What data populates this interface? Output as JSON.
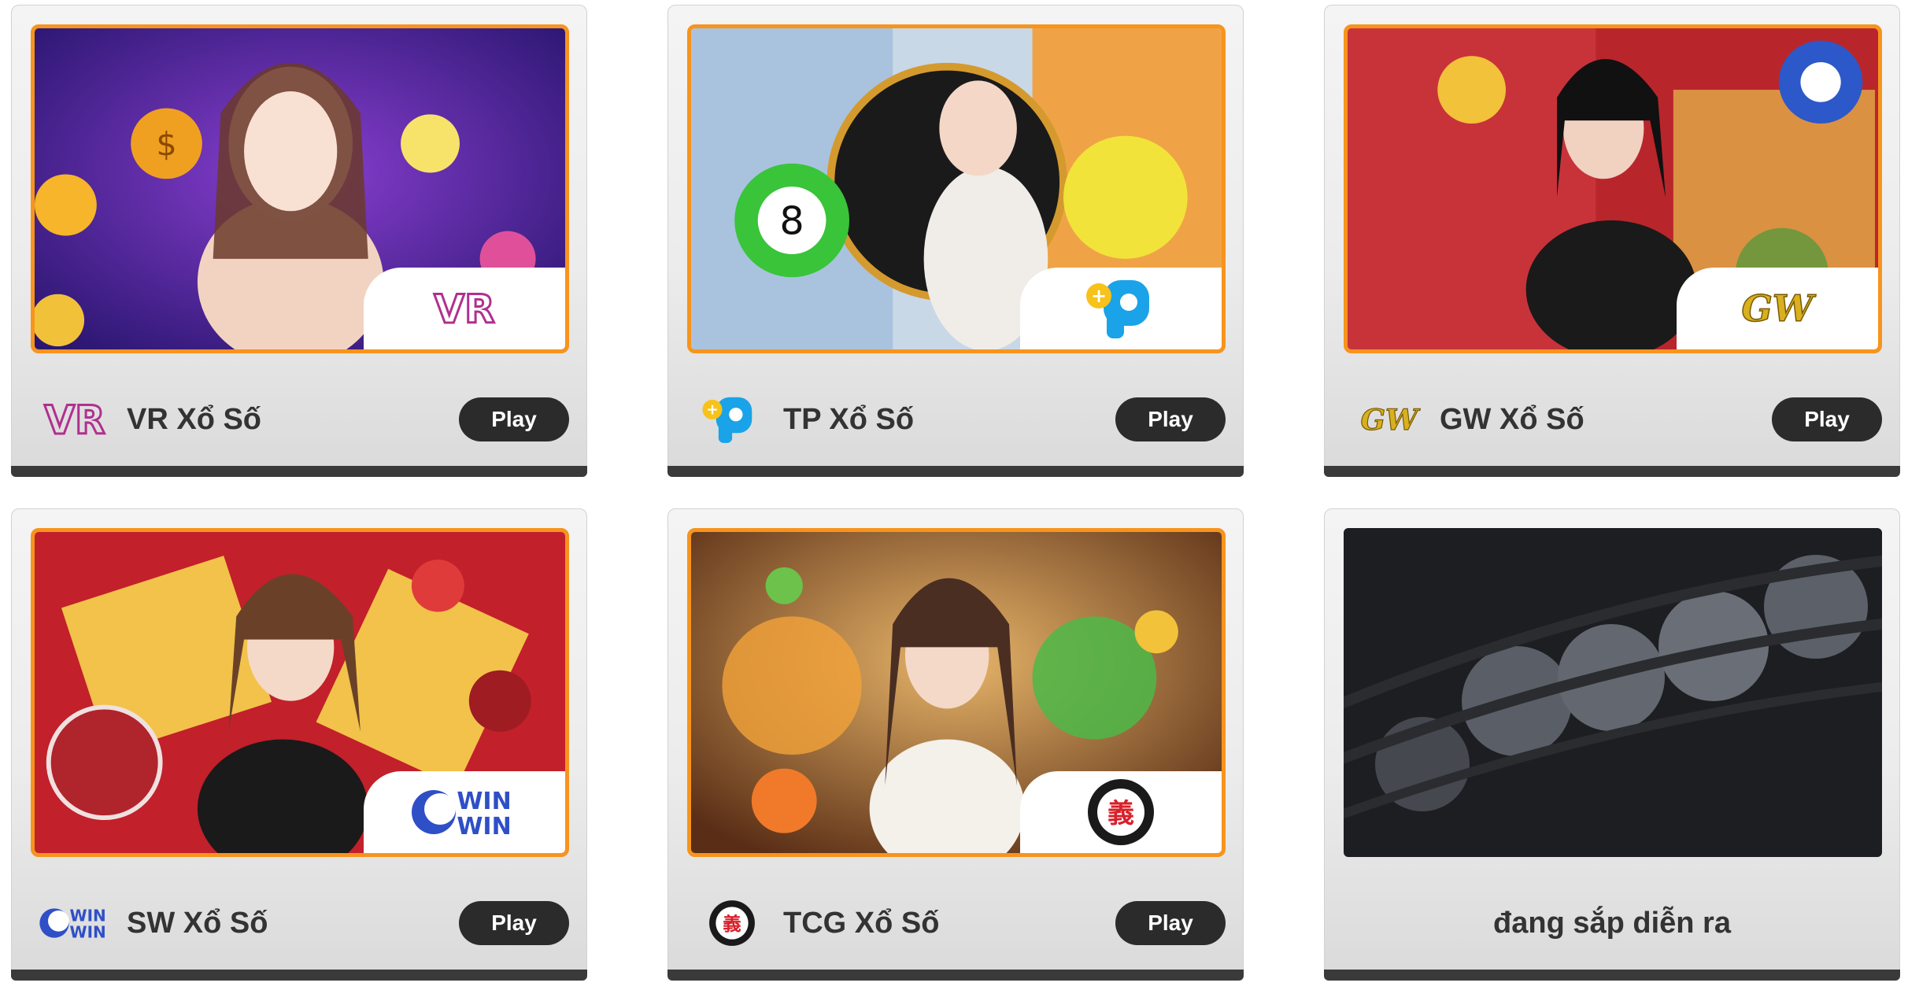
{
  "games": [
    {
      "name": "VR Xổ Số",
      "play_label": "Play",
      "provider_logo": "vr-logo-icon"
    },
    {
      "name": "TP Xổ Số",
      "play_label": "Play",
      "provider_logo": "tp-logo-icon"
    },
    {
      "name": "GW Xổ Số",
      "play_label": "Play",
      "provider_logo": "gw-logo-icon"
    },
    {
      "name": "SW Xổ Số",
      "play_label": "Play",
      "provider_logo": "sw-winwin-logo-icon"
    },
    {
      "name": "TCG Xổ Số",
      "play_label": "Play",
      "provider_logo": "tcg-logo-icon"
    }
  ],
  "coming_soon": {
    "label": "đang sắp diễn ra"
  },
  "logos": {
    "vr": "VR",
    "gw": "GW",
    "sw_top": "WIN",
    "sw_bottom": "WIN",
    "tcg": "義"
  },
  "colors": {
    "accent_border": "#f7941d",
    "button_bg": "#2b2b2b",
    "footer_bar": "#3a3a3a"
  }
}
